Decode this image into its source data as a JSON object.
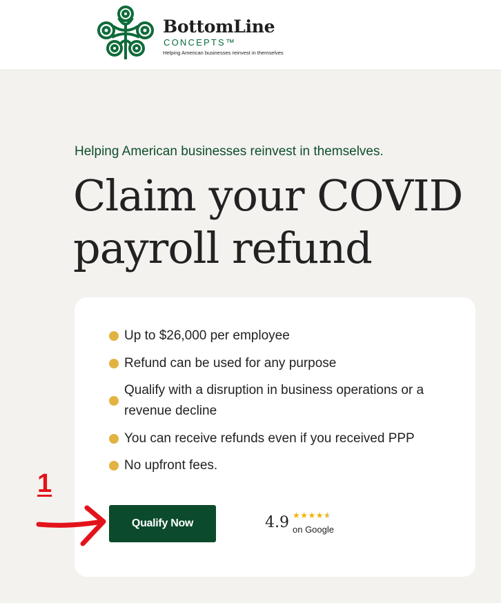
{
  "header": {
    "brand_name": "BottomLine",
    "brand_sub": "CONCEPTS™",
    "brand_tagline": "Helping American businesses reinvest in themselves",
    "logo_icon": "celtic-knot-logo-icon"
  },
  "hero": {
    "eyebrow": "Helping American businesses reinvest in themselves.",
    "headline_line1": "Claim your COVID",
    "headline_line2": "payroll refund"
  },
  "card": {
    "bullets": [
      "Up to $26,000 per employee",
      "Refund can be used for any purpose",
      "Qualify with a disruption in business operations or a revenue decline",
      "You can receive refunds even if you received PPP",
      "No upfront fees."
    ],
    "cta_label": "Qualify Now",
    "rating": {
      "value": "4.9",
      "stars": 4.5,
      "source": "on Google"
    }
  },
  "annotation": {
    "number": "1"
  },
  "colors": {
    "brand_green": "#0b4a2b",
    "bullet_gold": "#e3b342",
    "star_gold": "#f2b400",
    "annotation_red": "#e3131b",
    "page_bg": "#f3f2ef"
  }
}
